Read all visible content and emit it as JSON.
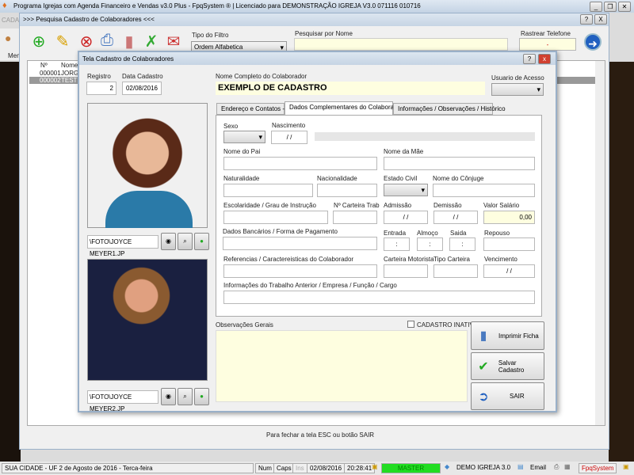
{
  "app": {
    "title": "Programa Igrejas com Agenda Financeiro e Vendas v3.0 Plus - FpqSystem ® | Licenciado para  DEMONSTRAÇÃO IGREJA V3.0 071116 010716",
    "side_label": "CADA",
    "menu_label": "Men"
  },
  "search_window": {
    "title": ">>> Pesquisa Cadastro de Colaboradores <<<",
    "filter_label": "Tipo do Filtro",
    "filter_value": "Ordem Alfabetica",
    "search_label": "Pesquisar por Nome",
    "search_value": "",
    "phone_label": "Rastrear Telefone",
    "phone_value": "-",
    "columns": [
      "Nº",
      "Nome"
    ],
    "rows": [
      {
        "num": "000001",
        "name": "JORGE"
      },
      {
        "num": "000002",
        "name": "TESTE"
      }
    ],
    "footer_hint": "Para fechar a tela ESC ou botão SAIR",
    "help_btn": "?",
    "close_btn": "X"
  },
  "modal": {
    "title": "Tela Cadastro de Colaboradores",
    "help_btn": "?",
    "close_btn": "x",
    "registro_label": "Registro",
    "registro_value": "2",
    "data_label": "Data Cadastro",
    "data_value": "02/08/2016",
    "nome_label": "Nome Completo do Colaborador",
    "nome_value": "EXEMPLO DE CADASTRO",
    "usuario_label": "Usuario de Acesso",
    "foto1_path": "\\FOTO\\JOYCE MEYER1.JP",
    "foto2_path": "\\FOTO\\JOYCE MEYER2.JP",
    "tabs": [
      "Endereço e Contatos ->",
      "Dados Complementares do Colaborador ->",
      "Informações / Observações / Histórico"
    ],
    "fields": {
      "sexo": "Sexo",
      "nascimento": "Nascimento",
      "nascimento_value": "/ /",
      "pai": "Nome do Pai",
      "mae": "Nome da Mãe",
      "naturalidade": "Naturalidade",
      "nacionalidade": "Nacionalidade",
      "estado_civil": "Estado Civil",
      "conjuge": "Nome do Cônjuge",
      "escolaridade": "Escolaridade / Grau de Instrução",
      "carteira_trab": "Nº Carteira Trab",
      "admissao": "Admissão",
      "admissao_value": "/ /",
      "demissao": "Demissão",
      "demissao_value": "/ /",
      "salario": "Valor Salário",
      "salario_value": "0,00",
      "bancarios": "Dados Bancários / Forma de Pagamento",
      "entrada": "Entrada",
      "almoco": "Almoço",
      "saida": "Saida",
      "hora_value": ":",
      "repouso": "Repouso",
      "referencias": "Referencias / Caractereisticas do Colaborador",
      "carteira_motorista": "Carteira Motorista",
      "tipo_carteira": "Tipo Carteira",
      "vencimento": "Vencimento",
      "vencimento_value": "/ /",
      "trabalho_anterior": "Informações do Trabalho Anterior / Empresa / Função / Cargo"
    },
    "obs_label": "Observações Gerais",
    "inativo_label": "CADASTRO INATIVO",
    "buttons": {
      "imprimir": "Imprimir Ficha",
      "salvar": "Salvar Cadastro",
      "sair": "SAIR"
    }
  },
  "status": {
    "city": "SUA CIDADE - UF  2 de Agosto de 2016 - Terca-feira",
    "num": "Num",
    "caps": "Caps",
    "ins": "Ins",
    "date": "02/08/2016",
    "time": "20:28:41",
    "user": "MASTER",
    "db": "DEMO IGREJA 3.0",
    "email": "Email",
    "brand": "FpqSystem"
  },
  "colors": {
    "accent_green": "#22dd22",
    "field_yellow": "#fefee0",
    "modal_border": "#9ab0c8"
  }
}
